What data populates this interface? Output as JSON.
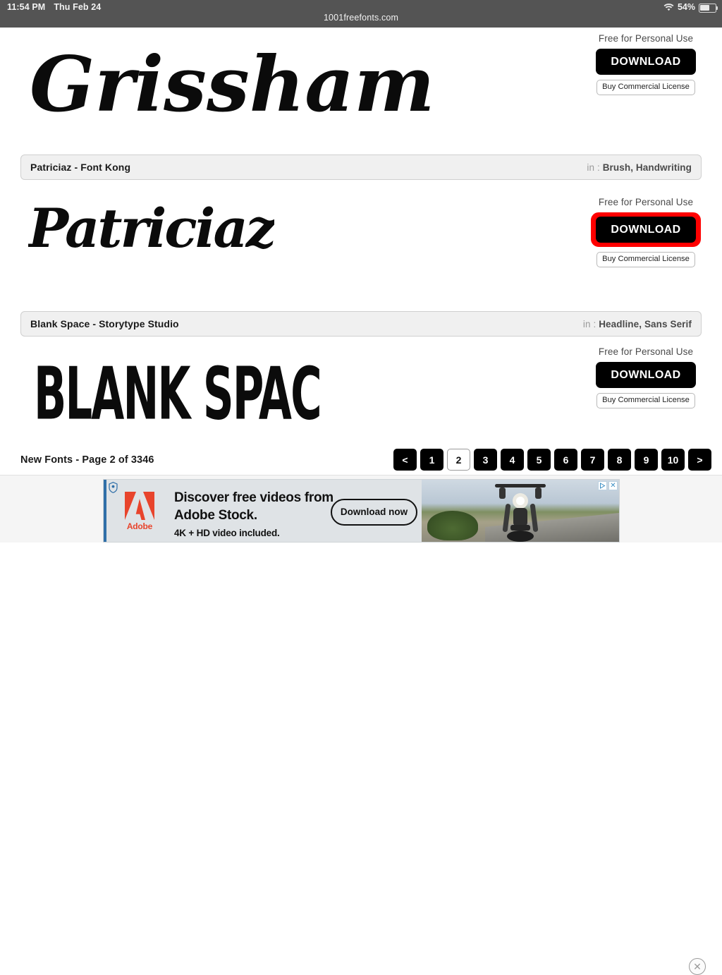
{
  "status_bar": {
    "time": "11:54 PM",
    "date": "Thu Feb 24",
    "battery_percent": "54%",
    "battery_level": 54,
    "wifi_icon": "wifi-icon",
    "battery_icon": "battery-icon"
  },
  "browser": {
    "url": "1001freefonts.com"
  },
  "fonts": [
    {
      "preview_text": "Grissham",
      "style": "script",
      "title": null,
      "categories_prefix": null,
      "categories": null,
      "license_label": "Free for Personal Use",
      "download_label": "DOWNLOAD",
      "commercial_label": "Buy Commercial License",
      "highlighted": false
    },
    {
      "preview_text": "Patriciaz",
      "style": "script",
      "title": "Patriciaz - Font Kong",
      "categories_prefix": "in : ",
      "categories": "Brush, Handwriting",
      "license_label": "Free for Personal Use",
      "download_label": "DOWNLOAD",
      "commercial_label": "Buy Commercial License",
      "highlighted": true
    },
    {
      "preview_text": "BLANK SPAC",
      "style": "blocky",
      "title": "Blank Space - Storytype Studio",
      "categories_prefix": "in : ",
      "categories": "Headline, Sans Serif",
      "license_label": "Free for Personal Use",
      "download_label": "DOWNLOAD",
      "commercial_label": "Buy Commercial License",
      "highlighted": false
    }
  ],
  "pagination": {
    "summary": "New Fonts - Page 2 of 3346",
    "current_page": "2",
    "items": [
      {
        "label": "<",
        "active": false,
        "name": "prev"
      },
      {
        "label": "1",
        "active": false,
        "name": "1"
      },
      {
        "label": "2",
        "active": true,
        "name": "2"
      },
      {
        "label": "3",
        "active": false,
        "name": "3"
      },
      {
        "label": "4",
        "active": false,
        "name": "4"
      },
      {
        "label": "5",
        "active": false,
        "name": "5"
      },
      {
        "label": "6",
        "active": false,
        "name": "6"
      },
      {
        "label": "7",
        "active": false,
        "name": "7"
      },
      {
        "label": "8",
        "active": false,
        "name": "8"
      },
      {
        "label": "9",
        "active": false,
        "name": "9"
      },
      {
        "label": "10",
        "active": false,
        "name": "10"
      },
      {
        "label": ">",
        "active": false,
        "name": "next"
      }
    ]
  },
  "ad": {
    "brand": "Adobe",
    "headline_line1": "Discover free videos from",
    "headline_line2": "Adobe Stock.",
    "subtext": "4K + HD video included.",
    "cta_label": "Download now",
    "adchoices_label": "AdChoices",
    "adchoices_close": "✕",
    "close_label": "✕"
  },
  "colors": {
    "statusbar_bg": "#545454",
    "button_black": "#000000",
    "highlight_red": "#ff0000",
    "title_bar_bg": "#f0f0f0",
    "adobe_red": "#e8442c"
  }
}
